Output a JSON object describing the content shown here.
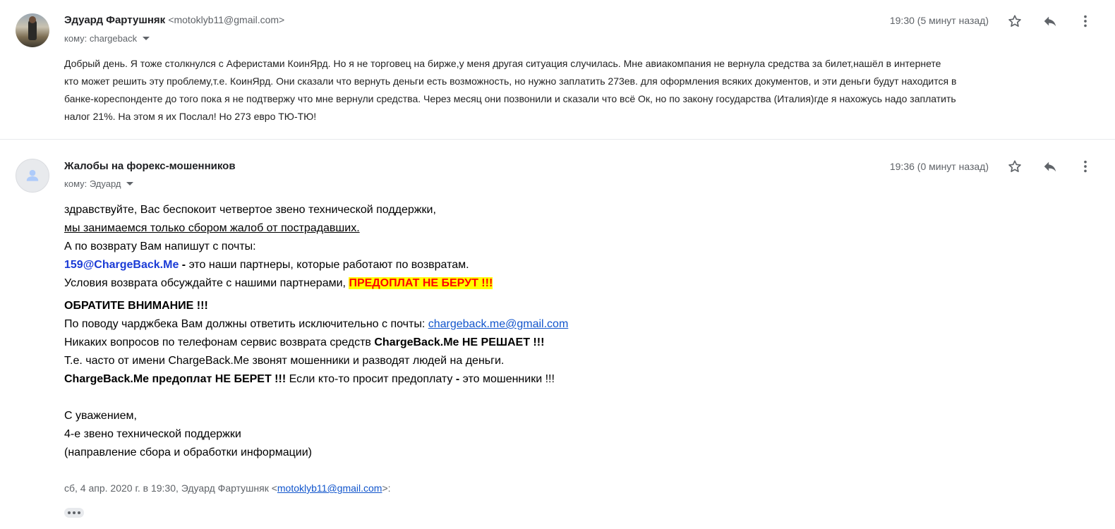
{
  "message1": {
    "sender_name": "Эдуард Фартушняк",
    "sender_email": "<motoklyb11@gmail.com>",
    "to": "кому: chargeback",
    "time": "19:30 (5 минут назад)",
    "body_lines": [
      "Добрый день. Я тоже столкнулся с Аферистами КоинЯрд. Но я не торговец на бирже,у меня другая ситуация случилась. Мне авиакомпания не вернула средства за билет,нашёл в интернете",
      "кто может решить эту проблему,т.е. КоинЯрд. Они сказали что вернуть деньги есть возможность, но нужно заплатить 273ев. для оформления всяких документов, и эти деньги будут находится в",
      "банке-кореспонденте до того пока я не подтвержу что мне вернули средства. Через месяц они позвонили и сказали что всё Ок, но по закону государства (Италия)где я нахожусь надо заплатить",
      "налог 21%. На этом я их Послал! Но 273 евро ТЮ-ТЮ!"
    ]
  },
  "message2": {
    "sender_name": "Жалобы на форекс-мошенников",
    "to": "кому: Эдуард",
    "time": "19:36 (0 минут назад)",
    "l1": "здравствуйте, Вас беспокоит четвертое звено технической поддержки,",
    "l2": "мы занимаемся только сбором жалоб от пострадавших.",
    "l3": "А по возврату Вам напишут с почты:",
    "l4_email": "159@ChargeBack.Me",
    "l4_dash": " - ",
    "l4_rest": "это наши партнеры, которые работают по возвратам.",
    "l5_text": "Условия возврата обсуждайте с нашими партнерами, ",
    "l5_highlight": "ПРЕДОПЛАТ НЕ БЕРУТ !!!",
    "l6": "ОБРАТИТЕ ВНИМАНИЕ !!!",
    "l7_text": "По поводу чарджбека Вам должны ответить исключительно с почты: ",
    "l7_link": "chargeback.me@gmail.com",
    "l8_text": "Никаких вопросов по телефонам сервис возврата средств ",
    "l8_bold": "ChargeBack.Me НЕ РЕШАЕТ !!!",
    "l9": "Т.е. часто от имени ChargeBack.Me звонят мошенники и разводят людей на деньги.",
    "l10_bold": "ChargeBack.Me предоплат НЕ БЕРЕТ !!!",
    "l10_text": " Если кто-то просит предоплату ",
    "l10_dash": "-",
    "l10_rest": " это мошенники !!!",
    "sig1": "С уважением,",
    "sig2": "4-е звено технической поддержки",
    "sig3": "(направление сбора и обработки информации)",
    "quote_prefix": "сб, 4 апр. 2020 г. в 19:30, Эдуард Фартушняк <",
    "quote_email": "motoklyb11@gmail.com",
    "quote_suffix": ">:"
  },
  "icons": [
    "star-icon",
    "reply-icon",
    "more-vert-icon",
    "caret-down-icon",
    "person-icon",
    "ellipsis-icon"
  ]
}
